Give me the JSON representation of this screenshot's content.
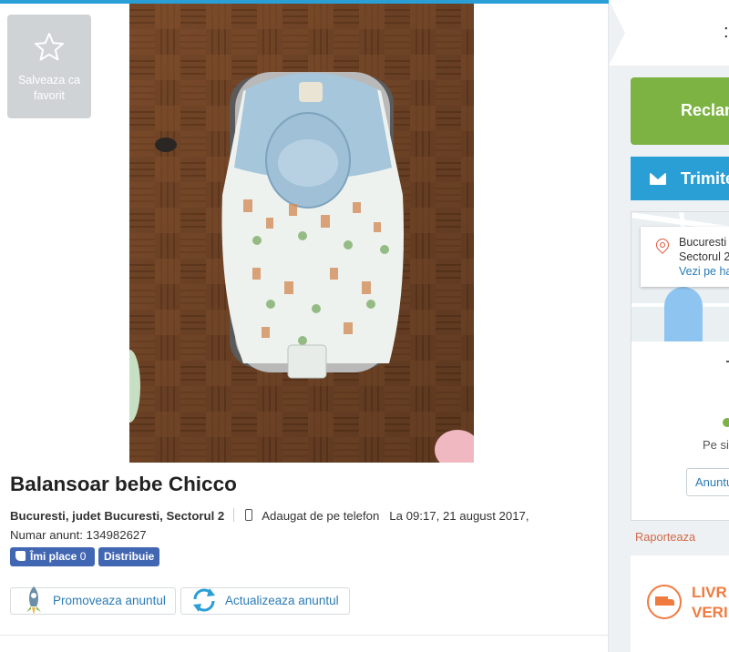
{
  "favorite": {
    "label": "Salveaza ca favorit"
  },
  "listing": {
    "title": "Balansoar bebe Chicco",
    "location": "Bucuresti, judet Bucuresti, Sectorul 2",
    "added_via": "Adaugat de pe telefon",
    "added_at": "La 09:17, 21 august 2017,",
    "ad_number": "Numar anunt: 134982627"
  },
  "social": {
    "like_label": "Îmi place",
    "like_count": "0",
    "share_label": "Distribuie"
  },
  "actions": {
    "promote_label": "Promoveaza anuntul",
    "update_label": "Actualizeaza anuntul"
  },
  "sidebar": {
    "price_partial": ":",
    "green_button": "Reclan",
    "blue_button": "Trimite",
    "address_line1": "Bucuresti",
    "address_line2": "Sectorul 2",
    "map_link": "Vezi pe ha",
    "pe_site": "Pe sit",
    "anunt_button": "Anuntu",
    "report": "Raporteaza",
    "delivery_line1": "LIVR",
    "delivery_line2": "VERI"
  },
  "colors": {
    "accent_blue": "#2a9fd6",
    "green": "#7cb342",
    "orange": "#f07b3f",
    "fb_blue": "#4267b2"
  }
}
